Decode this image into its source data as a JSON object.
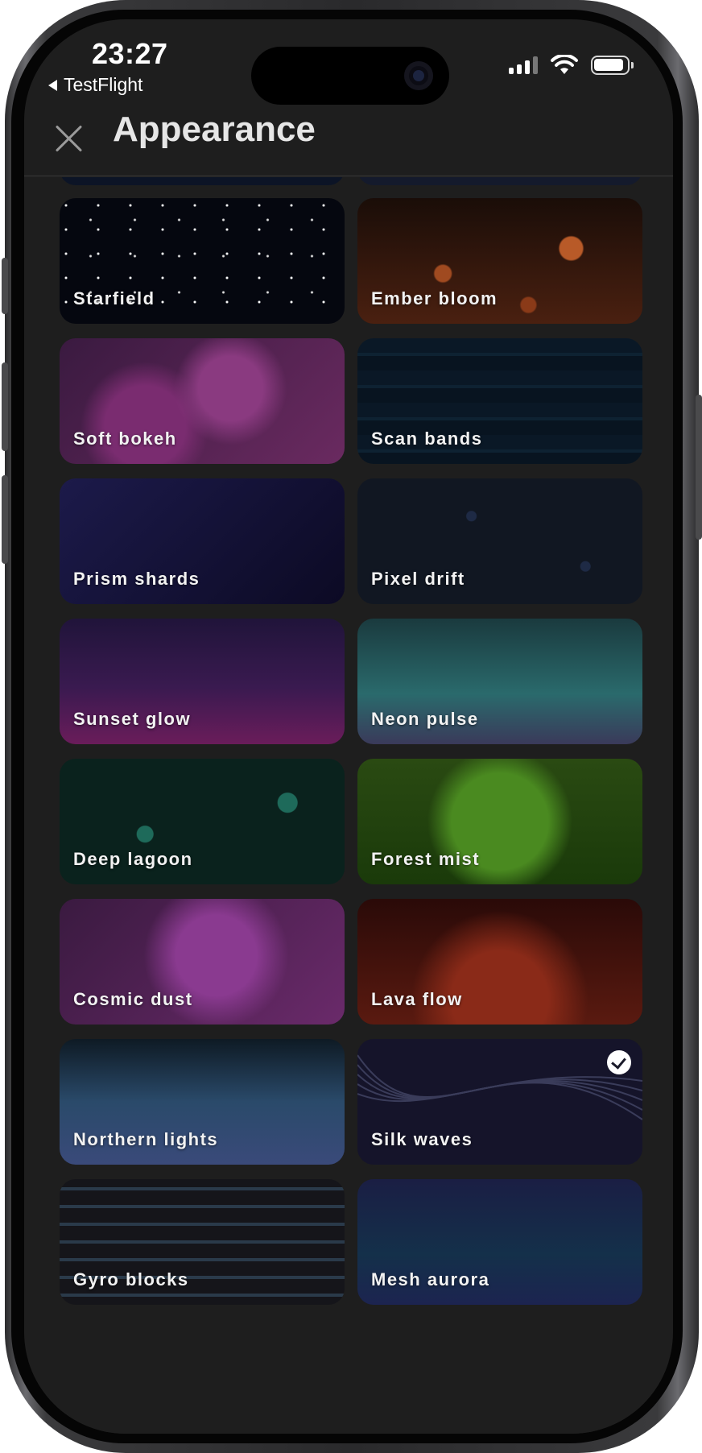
{
  "status": {
    "time": "23:27",
    "back_app": "TestFlight"
  },
  "header": {
    "title": "Appearance"
  },
  "selected_theme": "Silk waves",
  "themes": [
    {
      "label": "Starfield",
      "bg": "#05070f"
    },
    {
      "label": "Ember bloom",
      "bg": "#2a1208"
    },
    {
      "label": "Soft bokeh",
      "bg": "#5c2050"
    },
    {
      "label": "Scan bands",
      "bg": "#0b1c2a"
    },
    {
      "label": "Prism shards",
      "bg": "#140f2e"
    },
    {
      "label": "Pixel drift",
      "bg": "#121825"
    },
    {
      "label": "Sunset glow",
      "bg": "#3a1450"
    },
    {
      "label": "Neon pulse",
      "bg": "#1d4a4e"
    },
    {
      "label": "Deep lagoon",
      "bg": "#0a221d"
    },
    {
      "label": "Forest mist",
      "bg": "#2a5a10"
    },
    {
      "label": "Cosmic dust",
      "bg": "#54205c"
    },
    {
      "label": "Lava flow",
      "bg": "#5a1a10"
    },
    {
      "label": "Northern lights",
      "bg": "#1e3550"
    },
    {
      "label": "Silk waves",
      "bg": "#15142a"
    },
    {
      "label": "Gyro blocks",
      "bg": "#17171c"
    },
    {
      "label": "Mesh aurora",
      "bg": "#142a44"
    }
  ]
}
